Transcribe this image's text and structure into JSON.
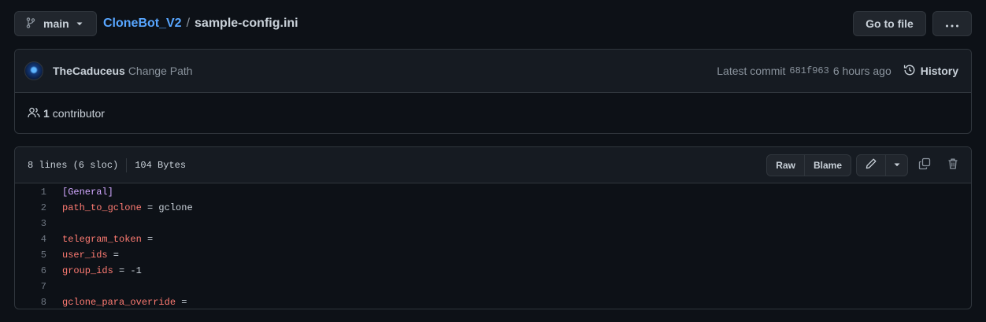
{
  "branch": {
    "label": "main"
  },
  "breadcrumb": {
    "repo": "CloneBot_V2",
    "separator": "/",
    "file": "sample-config.ini"
  },
  "actions": {
    "goto_file": "Go to file",
    "more": "···"
  },
  "commit": {
    "author": "TheCaduceus",
    "message": "Change Path",
    "latest_label": "Latest commit",
    "sha": "681f963",
    "time": "6 hours ago",
    "history_label": "History"
  },
  "contributors": {
    "count": "1",
    "label": "contributor"
  },
  "file": {
    "lines_info": "8 lines (6 sloc)",
    "size": "104 Bytes",
    "raw_label": "Raw",
    "blame_label": "Blame"
  },
  "code": {
    "line_numbers": [
      "1",
      "2",
      "3",
      "4",
      "5",
      "6",
      "7",
      "8"
    ],
    "l1": {
      "section": "[General]"
    },
    "l2": {
      "key": "path_to_gclone",
      "rest": " = gclone"
    },
    "l3": {
      "text": ""
    },
    "l4": {
      "key": "telegram_token",
      "rest": " ="
    },
    "l5": {
      "key": "user_ids",
      "rest": " ="
    },
    "l6": {
      "key": "group_ids",
      "rest": " = -1"
    },
    "l7": {
      "text": ""
    },
    "l8": {
      "key": "gclone_para_override",
      "rest": " ="
    }
  },
  "colors": {
    "background": "#0d1117",
    "link": "#58a6ff",
    "section": "#d2a8ff",
    "key": "#ff7b72",
    "border": "#30363d"
  },
  "icons": [
    "branch-icon",
    "caret-down-icon",
    "history-icon",
    "people-icon",
    "pencil-icon",
    "copy-icon",
    "trash-icon"
  ]
}
